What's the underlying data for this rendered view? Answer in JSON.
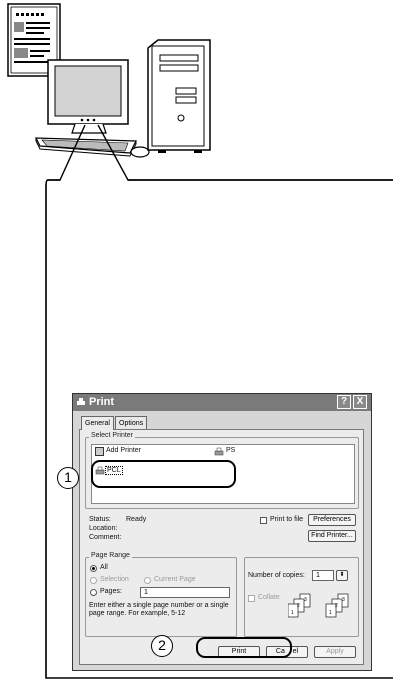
{
  "dialog": {
    "title": "Print",
    "help_label": "?",
    "close_label": "X",
    "tabs": [
      {
        "label": "General"
      },
      {
        "label": "Options"
      }
    ],
    "select_printer": {
      "group_label": "Select Printer",
      "printers": [
        {
          "label": "Add Printer"
        },
        {
          "label": "PS"
        },
        {
          "label": "PCL"
        }
      ]
    },
    "status": {
      "label": "Status:",
      "value": "Ready"
    },
    "location": {
      "label": "Location:"
    },
    "comment": {
      "label": "Comment:"
    },
    "print_to_file_label": "Print to file",
    "preferences_label": "Preferences",
    "find_printer_label": "Find Printer...",
    "page_range": {
      "group_label": "Page Range",
      "all_label": "All",
      "selection_label": "Selection",
      "current_page_label": "Current Page",
      "pages_label": "Pages:",
      "pages_value": "1",
      "hint": [
        "Enter either a single page number or a single",
        "page range.  For example, 5-12"
      ]
    },
    "copies": {
      "label": "Number of copies:",
      "value": "1"
    },
    "collate_label": "Collate",
    "buttons": {
      "print": "Print",
      "cancel": "Ca    el",
      "apply": "Apply"
    }
  },
  "callouts": {
    "one": "1",
    "two": "2"
  }
}
